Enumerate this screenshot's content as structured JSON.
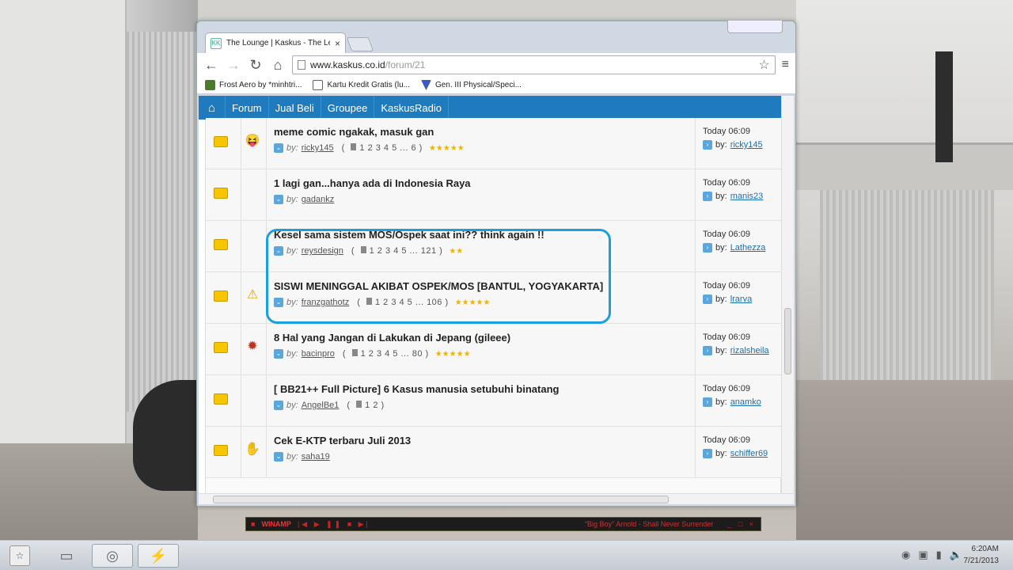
{
  "tab": {
    "title": "The Lounge | Kaskus - The Le",
    "favicon": "KK"
  },
  "url": {
    "host": "www.kaskus.co.id",
    "path": "/forum/21"
  },
  "bookmarks": [
    {
      "label": "Frost Aero by *minhtri...",
      "color": "#4a7a2a"
    },
    {
      "label": "Kartu Kredit Gratis (lu...",
      "color": "#2a6fb5"
    },
    {
      "label": "Gen. III Physical/Speci...",
      "color": "#3a5bbf"
    }
  ],
  "navbar": {
    "home": "⌂",
    "items": [
      "Forum",
      "Jual Beli",
      "Groupee",
      "KaskusRadio"
    ]
  },
  "threads": [
    {
      "title": "meme comic ngakak, masuk gan",
      "icon": "😝",
      "icon_name": "laugh-icon",
      "by": "by:",
      "user": "ricky145",
      "pages": "1 2 3 4 5 ... 6",
      "stars": "★★★★★",
      "time": "Today 06:09",
      "last_by": "by:",
      "last_user": "ricky145"
    },
    {
      "title": "1 lagi gan...hanya ada di Indonesia Raya",
      "icon": "",
      "icon_name": "none",
      "by": "by:",
      "user": "gadankz",
      "pages": "",
      "stars": "",
      "time": "Today 06:09",
      "last_by": "by:",
      "last_user": "manis23"
    },
    {
      "title": "Kesel sama sistem MOS/Ospek saat ini?? think again !!",
      "icon": "",
      "icon_name": "none",
      "by": "by:",
      "user": "reysdesign",
      "pages": "1 2 3 4 5 ... 121",
      "stars": "★★",
      "time": "Today 06:09",
      "last_by": "by:",
      "last_user": "Lathezza"
    },
    {
      "title": "SISWI MENINGGAL AKIBAT OSPEK/MOS [BANTUL, YOGYAKARTA]",
      "icon": "⚠",
      "icon_name": "warning-icon",
      "by": "by:",
      "user": "franzgathotz",
      "pages": "1 2 3 4 5 ... 106",
      "stars": "★★★★★",
      "time": "Today 06:09",
      "last_by": "by:",
      "last_user": "lrarva"
    },
    {
      "title": "8 Hal yang Jangan di Lakukan di Jepang (gileee)",
      "icon": "✹",
      "icon_name": "burst-icon",
      "by": "by:",
      "user": "bacinpro",
      "pages": "1 2 3 4 5 ... 80",
      "stars": "★★★★★",
      "time": "Today 06:09",
      "last_by": "by:",
      "last_user": "rizalsheila"
    },
    {
      "title": "[ BB21++ Full Picture] 6 Kasus manusia setubuhi binatang",
      "icon": "",
      "icon_name": "none",
      "by": "by:",
      "user": "AngelBe1",
      "pages": "1 2",
      "stars": "",
      "time": "Today 06:09",
      "last_by": "by:",
      "last_user": "anamko"
    },
    {
      "title": "Cek E-KTP terbaru Juli 2013",
      "icon": "✋",
      "icon_name": "hand-icon",
      "by": "by:",
      "user": "saha19",
      "pages": "",
      "stars": "",
      "time": "Today 06:09",
      "last_by": "by:",
      "last_user": "schiffer69"
    }
  ],
  "winamp": {
    "name": "WINAMP",
    "song": "\"Big Boy\" Arnold - Shall Never Surrender"
  },
  "clock": {
    "time": "6:20AM",
    "date": "7/21/2013"
  },
  "colors": {
    "navbar": "#1f7bbd",
    "highlight": "#1aa0e0",
    "folder": "#f7c600"
  }
}
